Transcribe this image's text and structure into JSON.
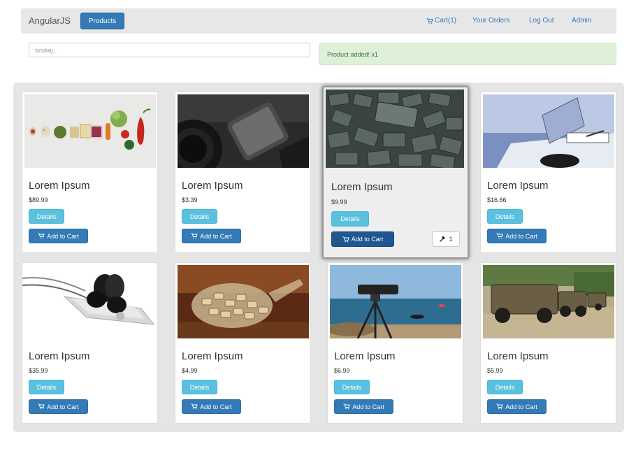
{
  "navbar": {
    "brand": "AngularJS",
    "products_label": "Products",
    "cart_label": "Cart(1)",
    "orders_label": "Your Orders",
    "logout_label": "Log Out",
    "admin_label": "Admin"
  },
  "search": {
    "placeholder": "szukaj..."
  },
  "alert": {
    "message": "Product added! x1"
  },
  "products": [
    {
      "title": "Lorem Ipsum",
      "price": "$89.99",
      "details": "Details",
      "add": "Add to Cart",
      "image": "vegetables"
    },
    {
      "title": "Lorem Ipsum",
      "price": "$3.39",
      "details": "Details",
      "add": "Add to Cart",
      "image": "phone-and-camera-lens"
    },
    {
      "title": "Lorem Ipsum",
      "price": "$9.99",
      "details": "Details",
      "add": "Add to Cart",
      "qty": "1",
      "image": "keyboard-keys"
    },
    {
      "title": "Lorem Ipsum",
      "price": "$16.66",
      "details": "Details",
      "add": "Add to Cart",
      "image": "turntable"
    },
    {
      "title": "Lorem Ipsum",
      "price": "$35.99",
      "details": "Details",
      "add": "Add to Cart",
      "image": "earphones-on-player"
    },
    {
      "title": "Lorem Ipsum",
      "price": "$4.99",
      "details": "Details",
      "add": "Add to Cart",
      "image": "corks-in-jar"
    },
    {
      "title": "Lorem Ipsum",
      "price": "$6.99",
      "details": "Details",
      "add": "Add to Cart",
      "image": "camera-on-tripod-sea"
    },
    {
      "title": "Lorem Ipsum",
      "price": "$5.99",
      "details": "Details",
      "add": "Add to Cart",
      "image": "military-vehicles"
    }
  ],
  "colors": {
    "primary": "#337ab7",
    "info": "#5bc0de",
    "success_bg": "#dff0d8",
    "success_text": "#3c763d",
    "navbar_bg": "#e7e7e7",
    "panel_bg": "#e5e5e5"
  }
}
